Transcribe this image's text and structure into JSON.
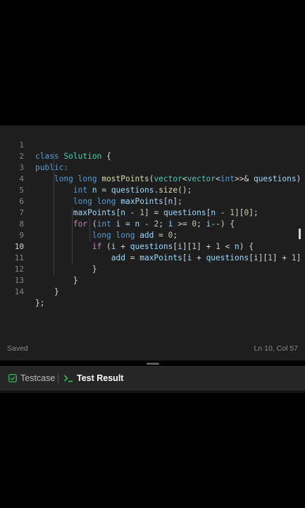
{
  "editor": {
    "line_numbers": [
      "1",
      "2",
      "3",
      "4",
      "5",
      "6",
      "7",
      "8",
      "9",
      "10",
      "11",
      "12",
      "13",
      "14"
    ],
    "active_line": "10",
    "code": {
      "l1_class": "class",
      "l1_name": "Solution",
      "l1_rest": " {",
      "l2_public": "public:",
      "l3_long": "long long",
      "l3_fn": "mostPoints",
      "l3_open": "(",
      "l3_vec1": "vector",
      "l3_lt1": "<",
      "l3_vec2": "vector",
      "l3_lt2": "<",
      "l3_int": "int",
      "l3_gt": ">>& ",
      "l3_q": "questions",
      "l3_close": ") {",
      "l4_int": "int",
      "l4_n": " n",
      "l4_eq": " = ",
      "l4_q": "questions",
      "l4_dot": ".",
      "l4_size": "size",
      "l4_rest": "();",
      "l5_long": "long long",
      "l5_mp": " maxPoints",
      "l5_br1": "[",
      "l5_n": "n",
      "l5_br2": "];",
      "l6_mp": "maxPoints",
      "l6_br1": "[",
      "l6_n": "n",
      "l6_m": " - ",
      "l6_one": "1",
      "l6_br2": "] = ",
      "l6_q": "questions",
      "l6_br3": "[",
      "l6_n2": "n",
      "l6_m2": " - ",
      "l6_one2": "1",
      "l6_br4": "][",
      "l6_zero": "0",
      "l6_end": "];",
      "l7_for": "for",
      "l7_p": " (",
      "l7_int": "int",
      "l7_i": " i",
      "l7_eq": " = ",
      "l7_n": "n",
      "l7_m": " - ",
      "l7_two": "2",
      "l7_semi": "; ",
      "l7_i2": "i",
      "l7_ge": " >= ",
      "l7_zero": "0",
      "l7_semi2": "; ",
      "l7_i3": "i",
      "l7_end": "--) {",
      "l8_long": "long long",
      "l8_add": " add",
      "l8_eq": " = ",
      "l8_zero": "0",
      "l8_end": ";",
      "l9_if": "if",
      "l9_p": " (",
      "l9_i": "i",
      "l9_plus": " + ",
      "l9_q": "questions",
      "l9_br1": "[",
      "l9_i2": "i",
      "l9_br2": "][",
      "l9_one": "1",
      "l9_br3": "] + ",
      "l9_one2": "1",
      "l9_lt": " < ",
      "l9_n": "n",
      "l9_end": ") {",
      "l10_add": "add",
      "l10_eq": " = ",
      "l10_mp": "maxPoints",
      "l10_br1": "[",
      "l10_i": "i",
      "l10_plus": " + ",
      "l10_q": "questions",
      "l10_br2": "[",
      "l10_i2": "i",
      "l10_br3": "][",
      "l10_one": "1",
      "l10_br4": "] + ",
      "l10_one2": "1",
      "l10_br5": "]",
      "l11": "}",
      "l12": "}",
      "l13": "}",
      "l14": "};"
    }
  },
  "status": {
    "saved": "Saved",
    "position": "Ln 10, Col 57"
  },
  "panel": {
    "testcase_label": "Testcase",
    "result_label": "Test Result"
  },
  "colors": {
    "keyword": "#569cd6",
    "control": "#c586c0",
    "type": "#4ec9b0",
    "function": "#dcdcaa",
    "variable": "#9cdcfe",
    "number": "#b5cea8",
    "check_icon": "#2cbb5d"
  },
  "icons": {
    "testcase": "checkbox-check-icon",
    "result": "terminal-prompt-icon"
  }
}
